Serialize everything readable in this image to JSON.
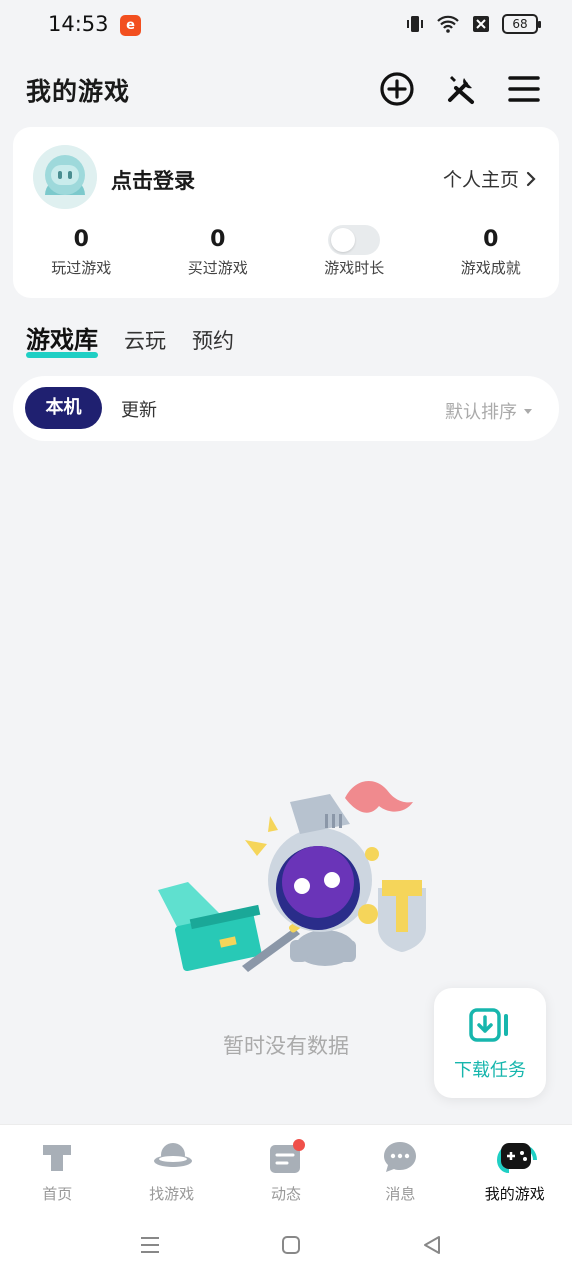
{
  "status": {
    "time": "14:53",
    "battery": "68"
  },
  "header": {
    "title": "我的游戏"
  },
  "profile": {
    "login_text": "点击登录",
    "home_link": "个人主页",
    "stats": [
      {
        "value": "0",
        "label": "玩过游戏"
      },
      {
        "value": "0",
        "label": "买过游戏"
      },
      {
        "label": "游戏时长"
      },
      {
        "value": "0",
        "label": "游戏成就"
      }
    ]
  },
  "tabs": [
    "游戏库",
    "云玩",
    "预约"
  ],
  "filter": {
    "local": "本机",
    "update": "更新",
    "sort": "默认排序"
  },
  "empty_state": {
    "text": "暂时没有数据"
  },
  "download": {
    "label": "下载任务"
  },
  "bottom_nav": [
    {
      "label": "首页"
    },
    {
      "label": "找游戏"
    },
    {
      "label": "动态"
    },
    {
      "label": "消息"
    },
    {
      "label": "我的游戏"
    }
  ],
  "colors": {
    "accent": "#1fcfc4",
    "primary_dark": "#1f2070",
    "badge": "#f0504a"
  }
}
